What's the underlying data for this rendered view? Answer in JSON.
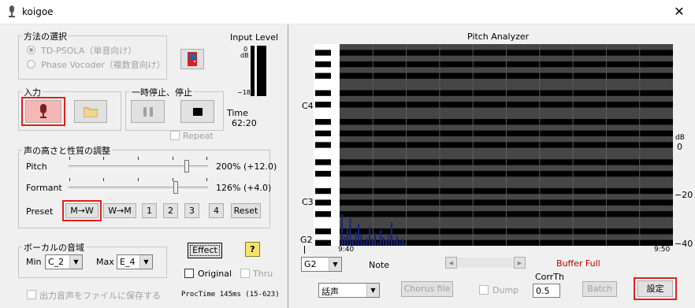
{
  "window": {
    "title": "koigoe",
    "close": "✕"
  },
  "method": {
    "legend": "方法の選択",
    "options": [
      {
        "label": "TD-PSOLA（単音向け）",
        "selected": true
      },
      {
        "label": "Phase Vocoder（複数音向け）",
        "selected": false
      }
    ]
  },
  "input_level": {
    "label": "Input Level",
    "top": "0",
    "unit": "dB",
    "bottom": "−18"
  },
  "input": {
    "legend": "入力"
  },
  "pause": {
    "legend": "一時停止、停止",
    "repeat_label": "Repeat"
  },
  "time": {
    "label": "Time",
    "value": "62:20"
  },
  "voice": {
    "legend": "声の高さと性質の調整",
    "pitch": {
      "label": "Pitch",
      "value": "200% (+12.0)",
      "level": 0.85
    },
    "formant": {
      "label": "Formant",
      "value": "126% (+4.0)",
      "level": 0.77
    },
    "preset_label": "Preset",
    "presets": [
      "M→W",
      "W→M",
      "1",
      "2",
      "3",
      "4",
      "Reset"
    ]
  },
  "range": {
    "legend": "ボーカルの音域",
    "min_label": "Min",
    "min_value": "C_2",
    "max_label": "Max",
    "max_value": "E_4"
  },
  "effect": {
    "label": "Effect",
    "help": "?",
    "original_label": "Original",
    "thru_label": "Thru"
  },
  "save_to_file": "出力音声をファイルに保存する",
  "proctime": "ProcTime 145ms (15-623)",
  "analyzer": {
    "title": "Pitch Analyzer",
    "notes": [
      "C4",
      "C3",
      "G2"
    ],
    "db_label": "dB",
    "db_ticks": [
      "0",
      "−20",
      "−40"
    ],
    "time_start": "9:40",
    "time_end": "9:50",
    "colors": {
      "grid": "#464646",
      "stripe": "#000000",
      "bars": "#1a237e"
    }
  },
  "bottom": {
    "note_select": "G2",
    "note_label": "Note",
    "buffer_status": "Buffer Full",
    "voice_type": "話声",
    "chorus_file": "Chorus file",
    "dump_label": "Dump",
    "corrth_label": "CorrTh",
    "corrth_value": "0.5",
    "batch": "Batch",
    "settings": "設定"
  }
}
